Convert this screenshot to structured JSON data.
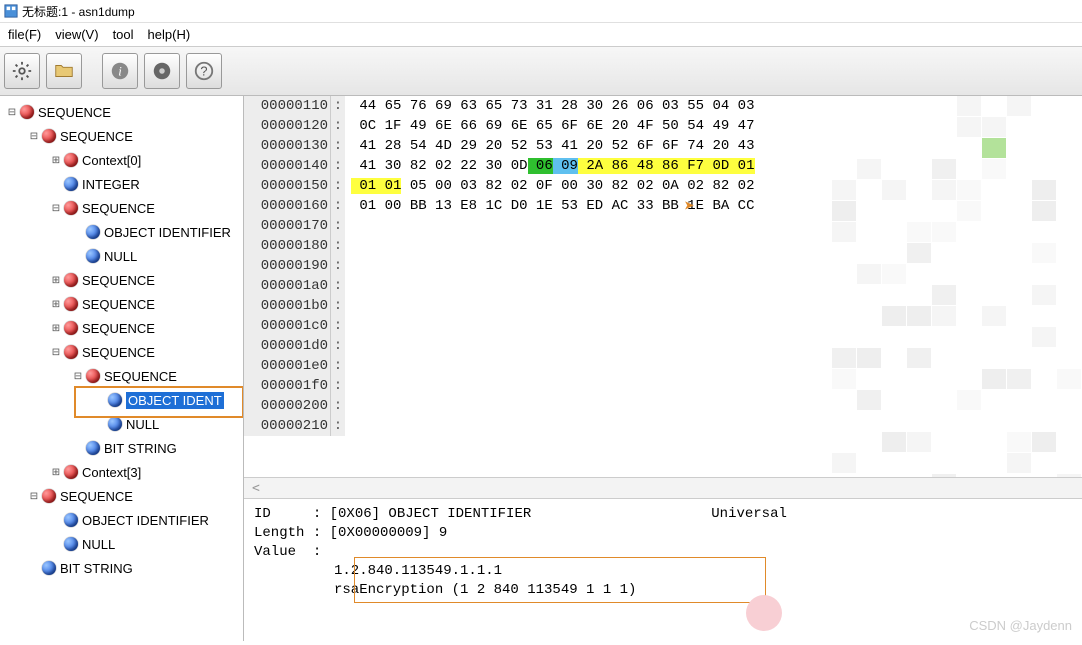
{
  "title": "无标题:1 - asn1dump",
  "menu": {
    "file": "file(F)",
    "view": "view(V)",
    "tool": "tool",
    "help": "help(H)"
  },
  "toolbar": {
    "settings": "settings",
    "open": "open",
    "info": "info",
    "save": "save",
    "help": "help"
  },
  "tree": {
    "items": [
      {
        "d": 0,
        "exp": "-",
        "col": "red",
        "label": "SEQUENCE"
      },
      {
        "d": 1,
        "exp": "-",
        "col": "red",
        "label": "SEQUENCE"
      },
      {
        "d": 2,
        "exp": "+",
        "col": "red",
        "label": "Context[0]"
      },
      {
        "d": 2,
        "exp": "",
        "col": "blue",
        "label": "INTEGER"
      },
      {
        "d": 2,
        "exp": "-",
        "col": "red",
        "label": "SEQUENCE"
      },
      {
        "d": 3,
        "exp": "",
        "col": "blue",
        "label": "OBJECT IDENTIFIER"
      },
      {
        "d": 3,
        "exp": "",
        "col": "blue",
        "label": "NULL"
      },
      {
        "d": 2,
        "exp": "+",
        "col": "red",
        "label": "SEQUENCE"
      },
      {
        "d": 2,
        "exp": "+",
        "col": "red",
        "label": "SEQUENCE"
      },
      {
        "d": 2,
        "exp": "+",
        "col": "red",
        "label": "SEQUENCE"
      },
      {
        "d": 2,
        "exp": "-",
        "col": "red",
        "label": "SEQUENCE"
      },
      {
        "d": 3,
        "exp": "-",
        "col": "red",
        "label": "SEQUENCE"
      },
      {
        "d": 4,
        "exp": "",
        "col": "blue",
        "label": "OBJECT IDENT",
        "sel": true
      },
      {
        "d": 4,
        "exp": "",
        "col": "blue",
        "label": "NULL"
      },
      {
        "d": 3,
        "exp": "",
        "col": "blue",
        "label": "BIT STRING"
      },
      {
        "d": 2,
        "exp": "+",
        "col": "red",
        "label": "Context[3]"
      },
      {
        "d": 1,
        "exp": "-",
        "col": "red",
        "label": "SEQUENCE"
      },
      {
        "d": 2,
        "exp": "",
        "col": "blue",
        "label": "OBJECT IDENTIFIER"
      },
      {
        "d": 2,
        "exp": "",
        "col": "blue",
        "label": "NULL"
      },
      {
        "d": 1,
        "exp": "",
        "col": "blue",
        "label": "BIT STRING"
      }
    ]
  },
  "hex": {
    "rows": [
      {
        "addr": "00000110",
        "bytes": [
          "44",
          "65",
          "76",
          "69",
          "63",
          "65",
          "73",
          "31",
          "28",
          "30",
          "26",
          "06",
          "03",
          "55",
          "04",
          "03"
        ]
      },
      {
        "addr": "00000120",
        "bytes": [
          "0C",
          "1F",
          "49",
          "6E",
          "66",
          "69",
          "6E",
          "65",
          "6F",
          "6E",
          "20",
          "4F",
          "50",
          "54",
          "49",
          "47"
        ]
      },
      {
        "addr": "00000130",
        "bytes": [
          "41",
          "28",
          "54",
          "4D",
          "29",
          "20",
          "52",
          "53",
          "41",
          "20",
          "52",
          "6F",
          "6F",
          "74",
          "20",
          "43"
        ]
      },
      {
        "addr": "00000140",
        "bytes": [
          "41",
          "30",
          "82",
          "02",
          "22",
          "30",
          "0D",
          "06",
          "09",
          "2A",
          "86",
          "48",
          "86",
          "F7",
          "0D",
          "01"
        ],
        "hl": [
          {
            "i": 7,
            "c": "grn"
          },
          {
            "i": 8,
            "c": "blu"
          },
          {
            "i": 9,
            "c": "yel"
          },
          {
            "i": 10,
            "c": "yel"
          },
          {
            "i": 11,
            "c": "yel"
          },
          {
            "i": 12,
            "c": "yel"
          },
          {
            "i": 13,
            "c": "yel"
          },
          {
            "i": 14,
            "c": "yel"
          },
          {
            "i": 15,
            "c": "yel"
          }
        ]
      },
      {
        "addr": "00000150",
        "bytes": [
          "01",
          "01",
          "05",
          "00",
          "03",
          "82",
          "02",
          "0F",
          "00",
          "30",
          "82",
          "02",
          "0A",
          "02",
          "82",
          "02"
        ],
        "hl": [
          {
            "i": 0,
            "c": "yel"
          },
          {
            "i": 1,
            "c": "yel"
          }
        ]
      },
      {
        "addr": "00000160",
        "bytes": [
          "01",
          "00",
          "BB",
          "13",
          "E8",
          "1C",
          "D0",
          "1E",
          "53",
          "ED",
          "AC",
          "33",
          "BB",
          "1E",
          "BA",
          "CC"
        ]
      },
      {
        "addr": "00000170",
        "bytes": []
      },
      {
        "addr": "00000180",
        "bytes": []
      },
      {
        "addr": "00000190",
        "bytes": []
      },
      {
        "addr": "000001a0",
        "bytes": []
      },
      {
        "addr": "000001b0",
        "bytes": []
      },
      {
        "addr": "000001c0",
        "bytes": []
      },
      {
        "addr": "000001d0",
        "bytes": []
      },
      {
        "addr": "000001e0",
        "bytes": []
      },
      {
        "addr": "000001f0",
        "bytes": []
      },
      {
        "addr": "00000200",
        "bytes": []
      },
      {
        "addr": "00000210",
        "bytes": []
      }
    ]
  },
  "detail": {
    "id_label": "ID",
    "id_val": "[0X06] OBJECT IDENTIFIER",
    "class": "Universal",
    "len_label": "Length",
    "len_val": "[0X00000009] 9",
    "val_label": "Value",
    "oid": "1.2.840.113549.1.1.1",
    "oid_name": "rsaEncryption (1 2 840 113549 1 1 1)"
  },
  "watermark": "CSDN @Jaydenn",
  "splitter_glyph": "<"
}
